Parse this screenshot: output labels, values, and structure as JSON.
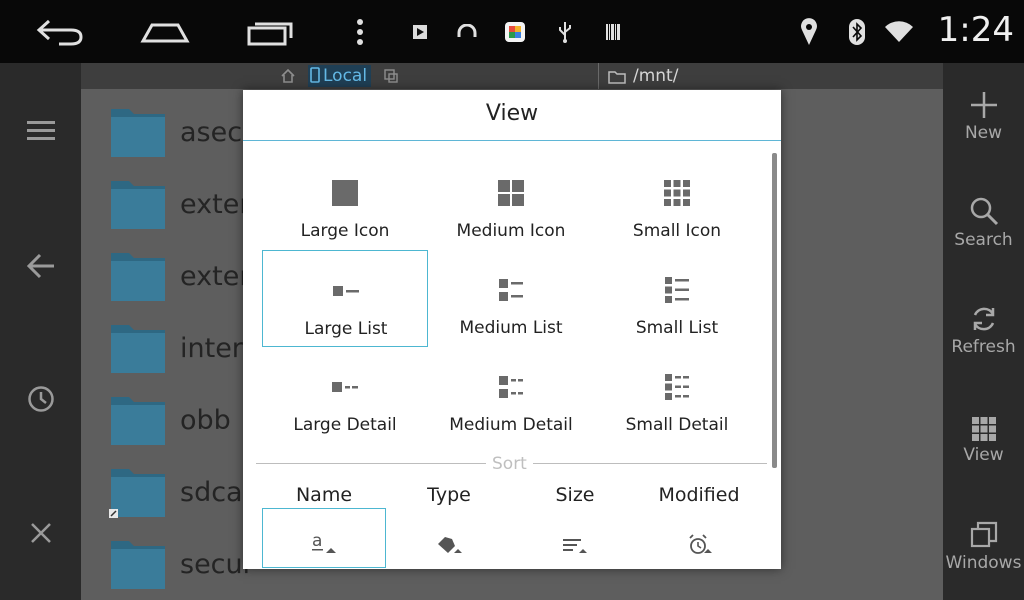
{
  "status_bar": {
    "time": "1:24",
    "left_icons": [
      "back-icon",
      "home-icon",
      "recents-icon",
      "more-vert-icon",
      "play-store-icon",
      "headset-icon",
      "photo-app-icon",
      "usb-icon",
      "barcode-icon"
    ],
    "right_icons": [
      "location-icon",
      "bluetooth-icon",
      "wifi-icon"
    ]
  },
  "left_nav": {
    "icons": [
      "menu-icon",
      "back-arrow-icon",
      "history-icon",
      "close-icon"
    ]
  },
  "path_bar": {
    "location": "Local",
    "path": "/mnt/"
  },
  "files": [
    {
      "name": "asec"
    },
    {
      "name": "extern"
    },
    {
      "name": "extern"
    },
    {
      "name": "intern"
    },
    {
      "name": "obb"
    },
    {
      "name": "sdcar"
    },
    {
      "name": "secur"
    }
  ],
  "right_bar": {
    "items": [
      {
        "label": "New",
        "icon": "plus-icon"
      },
      {
        "label": "Search",
        "icon": "search-icon"
      },
      {
        "label": "Refresh",
        "icon": "refresh-icon"
      },
      {
        "label": "View",
        "icon": "grid-icon"
      },
      {
        "label": "Windows",
        "icon": "windows-icon"
      }
    ]
  },
  "dialog": {
    "title": "View",
    "options": [
      {
        "label": "Large Icon"
      },
      {
        "label": "Medium Icon"
      },
      {
        "label": "Small Icon"
      },
      {
        "label": "Large List",
        "selected": true
      },
      {
        "label": "Medium List"
      },
      {
        "label": "Small List"
      },
      {
        "label": "Large Detail"
      },
      {
        "label": "Medium Detail"
      },
      {
        "label": "Small Detail"
      }
    ],
    "sort_label": "Sort",
    "sort_options": [
      {
        "label": "Name",
        "selected": true
      },
      {
        "label": "Type"
      },
      {
        "label": "Size"
      },
      {
        "label": "Modified"
      }
    ]
  },
  "colors": {
    "accent": "#4db7d1",
    "folder": "#3a7c9a",
    "location_highlight": "#64b9e6"
  }
}
